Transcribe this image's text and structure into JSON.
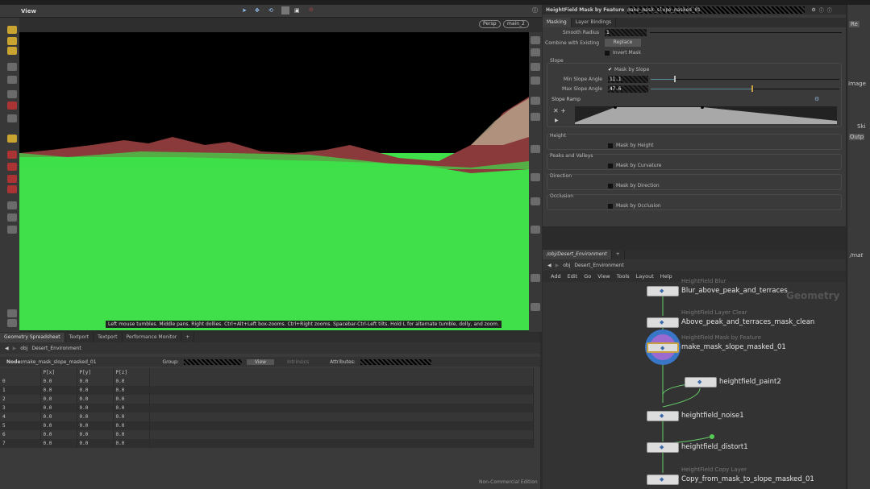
{
  "viewport": {
    "title": "View",
    "camera": "Persp",
    "view_name": "main_2",
    "hint": "Left mouse tumbles. Middle pans. Right dollies. Ctrl+Alt+Left box-zooms. Ctrl+Right zooms. Spacebar-Ctrl-Left tilts. Hold L for alternate tumble, dolly, and zoom.",
    "colors": {
      "sky": "#000000",
      "ground": "#3fe04a",
      "mask": "#8a3a3a"
    }
  },
  "params": {
    "node_type": "HeightField Mask by Feature",
    "node_name": "make_mask_slope_masked_01",
    "tabs": [
      "Masking",
      "Layer Bindings"
    ],
    "smooth_radius_label": "Smooth Radius",
    "smooth_radius": "1",
    "combine_label": "Combine with Existing",
    "combine_value": "Replace",
    "invert_mask": "Invert Mask",
    "slope": {
      "title": "Slope",
      "mask_by_slope": "Mask by Slope",
      "min_label": "Min Slope Angle",
      "min": "11.1",
      "max_label": "Max Slope Angle",
      "max": "47.6",
      "ramp_label": "Slope Ramp"
    },
    "sections": [
      {
        "title": "Height",
        "toggle": "Mask by Height"
      },
      {
        "title": "Peaks and Valleys",
        "toggle": "Mask by Curvature"
      },
      {
        "title": "Direction",
        "toggle": "Mask by Direction"
      },
      {
        "title": "Occlusion",
        "toggle": "Mask by Occlusion"
      }
    ]
  },
  "spreadsheet": {
    "tabs": [
      "Geometry Spreadsheet",
      "Textport",
      "Textport",
      "Performance Monitor"
    ],
    "path": [
      "obj",
      "Desert_Environment"
    ],
    "node_label": "Node:",
    "node": "make_mask_slope_masked_01",
    "group_label": "Group:",
    "view": "View",
    "intrinsics": "Intrinsics",
    "attributes_label": "Attributes:",
    "columns": [
      "",
      "P[x]",
      "P[y]",
      "P[z]"
    ],
    "rows": [
      [
        "0",
        "0.0",
        "0.0",
        "0.0"
      ],
      [
        "1",
        "0.0",
        "0.0",
        "0.0"
      ],
      [
        "2",
        "0.0",
        "0.0",
        "0.0"
      ],
      [
        "3",
        "0.0",
        "0.0",
        "0.0"
      ],
      [
        "4",
        "0.0",
        "0.0",
        "0.0"
      ],
      [
        "5",
        "0.0",
        "0.0",
        "0.0"
      ],
      [
        "6",
        "0.0",
        "0.0",
        "0.0"
      ],
      [
        "7",
        "0.0",
        "0.0",
        "0.0"
      ]
    ]
  },
  "network": {
    "tab": "/obj/Desert_Environment",
    "path": [
      "obj",
      "Desert_Environment"
    ],
    "menu": [
      "Add",
      "Edit",
      "Go",
      "View",
      "Tools",
      "Layout",
      "Help"
    ],
    "context": "Geometry",
    "edition": "Non-Commercial Edition",
    "nodes": [
      {
        "type": "HeightField Blur",
        "name": "Blur_above_peak_and_terraces"
      },
      {
        "type": "HeightField Layer Clear",
        "name": "Above_peak_and_terraces_mask_clean"
      },
      {
        "type": "HeightField Mask by Feature",
        "name": "make_mask_slope_masked_01"
      },
      {
        "type": "",
        "name": "heightfield_paint2"
      },
      {
        "type": "",
        "name": "heightfield_noise1"
      },
      {
        "type": "",
        "name": "heightfield_distort1"
      },
      {
        "type": "HeightField Copy Layer",
        "name": "Copy_from_mask_to_slope_masked_01"
      }
    ]
  },
  "side": {
    "tab": "/mat",
    "labels": [
      "Re",
      "Image",
      "Ski",
      "Outp"
    ]
  }
}
